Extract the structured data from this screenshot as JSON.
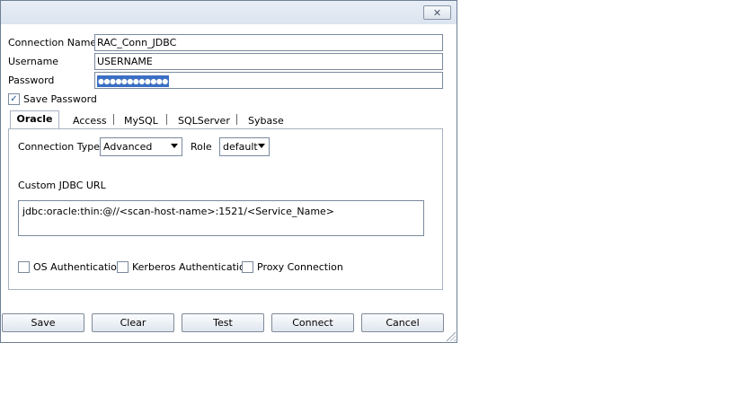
{
  "titlebar": {
    "close_glyph": "✕",
    "close_icon": "close-icon"
  },
  "form": {
    "connection_name_label": "Connection Name",
    "connection_name_value": "RAC_Conn_JDBC",
    "username_label": "Username",
    "username_value": "USERNAME",
    "password_label": "Password",
    "password_value": "●●●●●●●●●●●●",
    "save_password_label": "Save Password",
    "save_password_checked": "✓"
  },
  "tabs": [
    "Oracle",
    "Access",
    "MySQL",
    "SQLServer",
    "Sybase"
  ],
  "oracle": {
    "connection_type_label": "Connection Type",
    "connection_type_value": "Advanced",
    "role_label": "Role",
    "role_value": "default",
    "custom_url_label": "Custom JDBC URL",
    "custom_url_value": "jdbc:oracle:thin:@//<scan-host-name>:1521/<Service_Name>",
    "os_auth_label": "OS Authentication",
    "kerberos_auth_label": "Kerberos Authentication",
    "proxy_label": "Proxy Connection"
  },
  "buttons": {
    "save": "Save",
    "clear": "Clear",
    "test": "Test",
    "connect": "Connect",
    "cancel": "Cancel"
  },
  "colors": {
    "selection": "#3a6fc4",
    "check": "#1f4f9a"
  }
}
